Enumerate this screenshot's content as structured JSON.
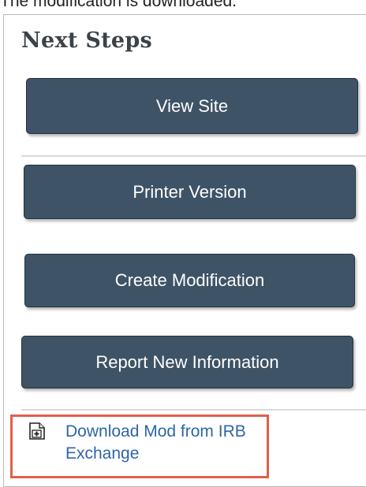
{
  "caption": "The modification is downloaded.",
  "panel": {
    "title": "Next Steps",
    "buttons": {
      "view_site": "View Site",
      "printer_version": "Printer Version",
      "create_modification": "Create Modification",
      "report_new_information": "Report New Information"
    },
    "download_link": {
      "label": "Download Mod from IRB Exchange",
      "icon": "document-plus-icon"
    }
  },
  "colors": {
    "button_fill": "#3e5366",
    "link": "#2e66a8",
    "highlight_border": "#e0604a"
  }
}
